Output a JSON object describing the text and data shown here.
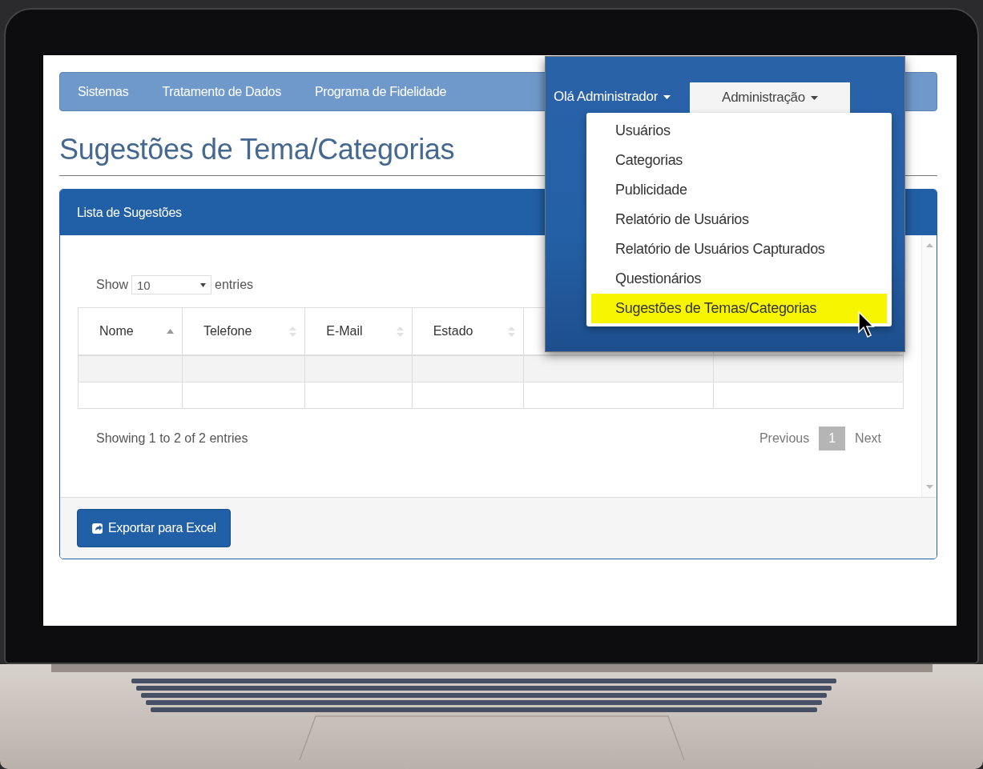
{
  "navbar": {
    "items": [
      "Sistemas",
      "Tratamento de Dados",
      "Programa de Fidelidade"
    ]
  },
  "page_title": "Sugestões de Tema/Categorias",
  "panel": {
    "title": "Lista de Sugestões",
    "show_label": "Show",
    "page_size": "10",
    "entries_label": "entries",
    "columns": [
      {
        "label": "Nome",
        "sorted": true
      },
      {
        "label": "Telefone",
        "sorted": false
      },
      {
        "label": "E-Mail",
        "sorted": false
      },
      {
        "label": "Estado",
        "sorted": false
      }
    ],
    "info": "Showing 1 to 2 of 2 entries",
    "pagination": {
      "previous": "Previous",
      "pages": [
        {
          "label": "1",
          "selected": true
        }
      ],
      "next": "Next"
    },
    "export_button": "Exportar para Excel"
  },
  "popup": {
    "user_menu": "Olá Administrador",
    "admin_menu": {
      "label": "Administração",
      "expanded": true
    },
    "items": [
      {
        "label": "Usuários",
        "selected": false
      },
      {
        "label": "Categorias",
        "selected": false
      },
      {
        "label": "Publicidade",
        "selected": false
      },
      {
        "label": "Relatório de Usuários",
        "selected": false
      },
      {
        "label": "Relatório de Usuários Capturados",
        "selected": false
      },
      {
        "label": "Questionários",
        "selected": false
      },
      {
        "label": "Sugestões de Temas/Categorias",
        "selected": true
      }
    ]
  }
}
